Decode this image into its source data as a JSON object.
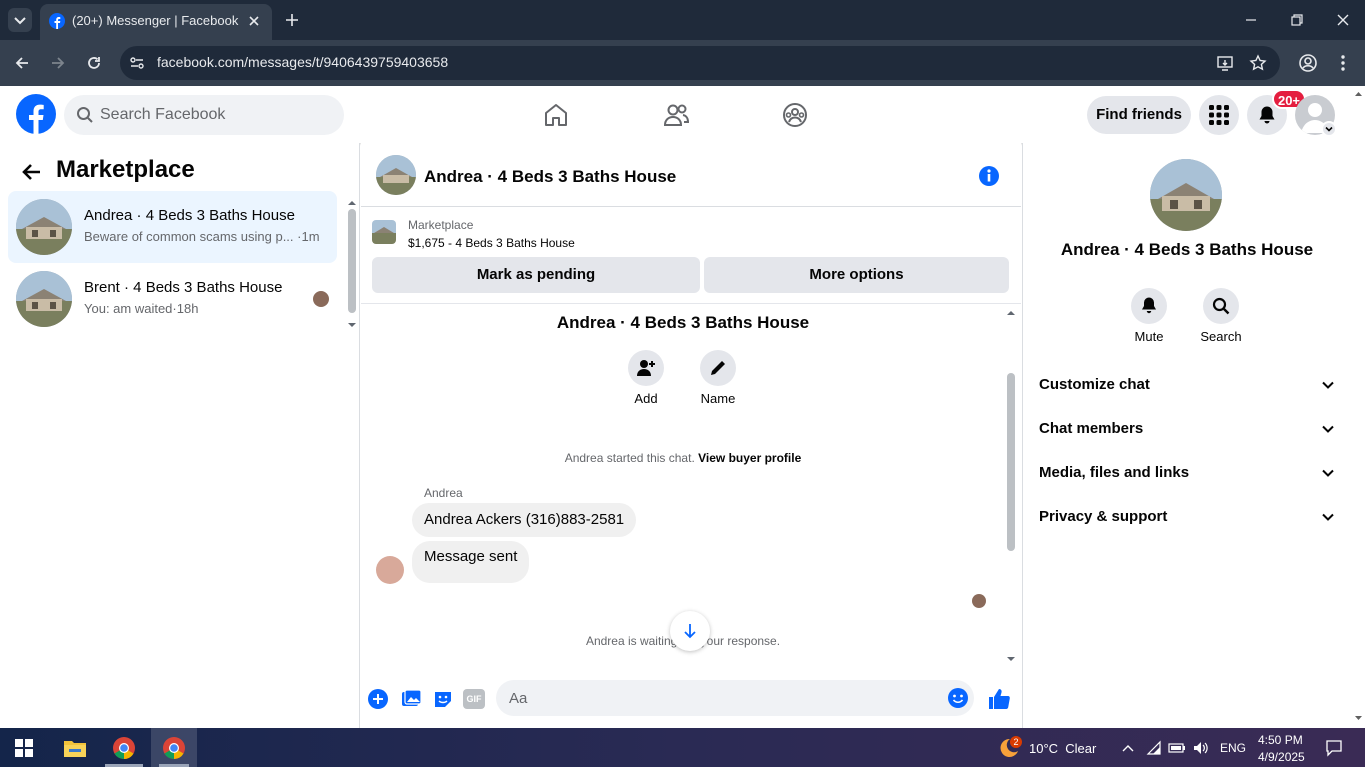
{
  "browser": {
    "tab_title": "(20+) Messenger | Facebook",
    "url": "facebook.com/messages/t/9406439759403658"
  },
  "fb_header": {
    "search_placeholder": "Search Facebook",
    "find_friends": "Find friends",
    "notification_badge": "20+",
    "brand_color": "#0866ff"
  },
  "sidebar": {
    "title": "Marketplace",
    "conversations": [
      {
        "name": "Andrea · 4 Beds 3 Baths House",
        "preview": "Beware of common scams using p...",
        "time": "·1m",
        "selected": true
      },
      {
        "name": "Brent · 4 Beds 3 Baths House",
        "preview": "You: am waited",
        "time": "·18h",
        "selected": false
      }
    ]
  },
  "chat": {
    "title": "Andrea · 4 Beds 3 Baths House",
    "listing_label": "Marketplace",
    "listing_desc": "$1,675 - 4 Beds 3 Baths House",
    "mark_pending": "Mark as pending",
    "more_options": "More options",
    "intro_title": "Andrea · 4 Beds 3 Baths House",
    "add_label": "Add",
    "name_label": "Name",
    "started_text": "Andrea started this chat.",
    "buyer_profile_link": "View buyer profile",
    "sender_name": "Andrea",
    "messages": [
      "Andrea  Ackers (316)883-2581",
      "Message sent"
    ],
    "waiting_before": "Andrea is waiting",
    "waiting_after": "your response.",
    "composer_placeholder": "Aa"
  },
  "details": {
    "title": "Andrea · 4 Beds 3 Baths House",
    "mute": "Mute",
    "search": "Search",
    "sections": [
      "Customize chat",
      "Chat members",
      "Media, files and links",
      "Privacy & support"
    ]
  },
  "taskbar": {
    "weather_badge": "2",
    "weather": "10°C  Clear",
    "lang": "ENG",
    "time": "4:50 PM",
    "date": "4/9/2025"
  }
}
